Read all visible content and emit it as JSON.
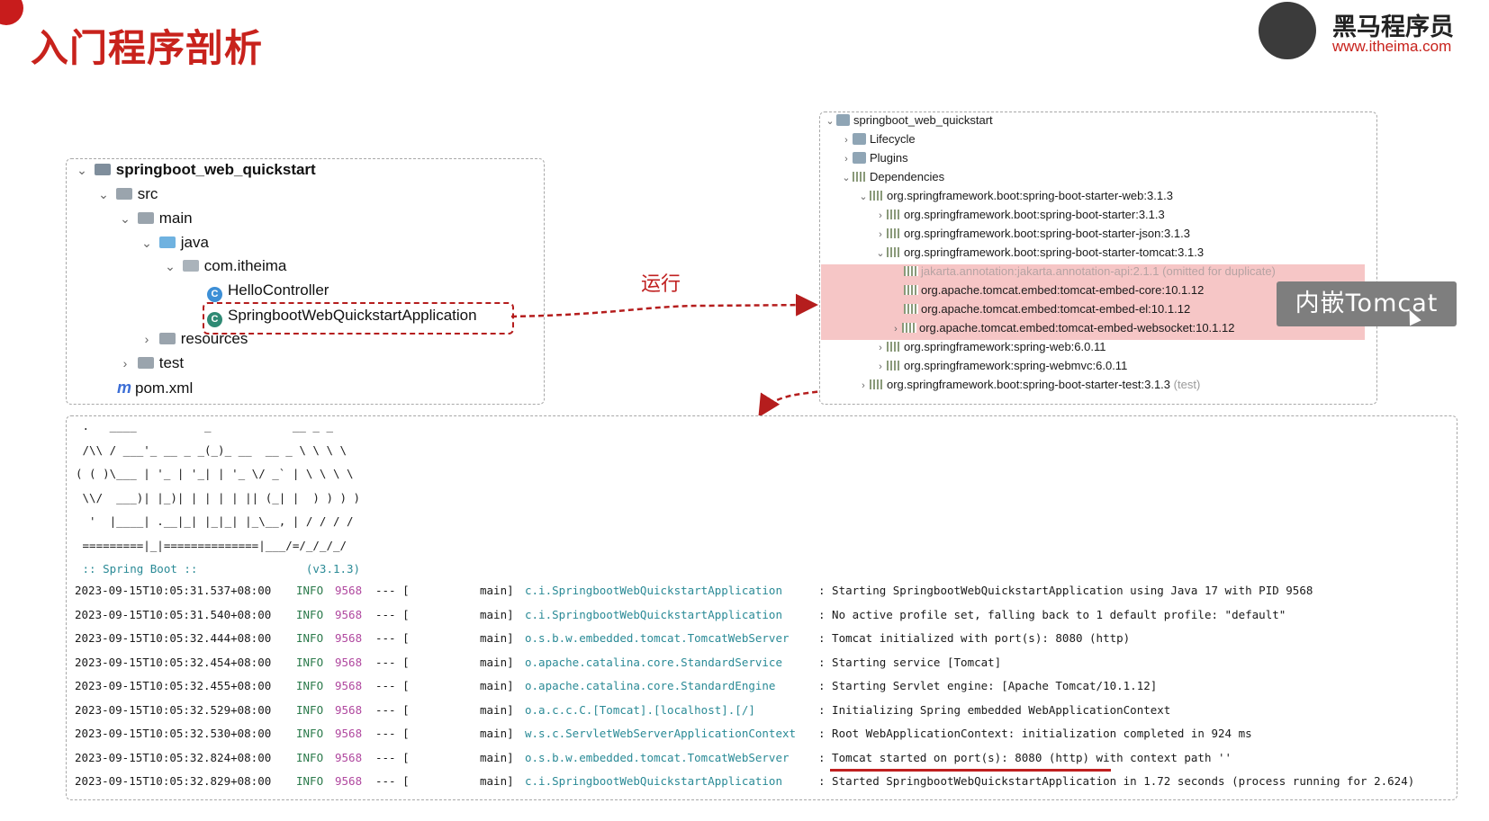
{
  "title": "入门程序剖析",
  "logo": {
    "name": "黑马程序员",
    "url": "www.itheima.com"
  },
  "run_label": "运行",
  "tooltip": "内嵌Tomcat",
  "project_tree": {
    "root": "springboot_web_quickstart",
    "src": "src",
    "main": "main",
    "java": "java",
    "package": "com.itheima",
    "hello": "HelloController",
    "app": "SpringbootWebQuickstartApplication",
    "resources": "resources",
    "test": "test",
    "pom": "pom.xml"
  },
  "maven_tree": {
    "root": "springboot_web_quickstart",
    "lifecycle": "Lifecycle",
    "plugins": "Plugins",
    "dependencies": "Dependencies",
    "starter_web": "org.springframework.boot:spring-boot-starter-web:3.1.3",
    "starter": "org.springframework.boot:spring-boot-starter:3.1.3",
    "starter_json": "org.springframework.boot:spring-boot-starter-json:3.1.3",
    "starter_tomcat": "org.springframework.boot:spring-boot-starter-tomcat:3.1.3",
    "annotation_api": "jakarta.annotation:jakarta.annotation-api:2.1.1",
    "annotation_note": "(omitted for duplicate)",
    "embed_core": "org.apache.tomcat.embed:tomcat-embed-core:10.1.12",
    "embed_el": "org.apache.tomcat.embed:tomcat-embed-el:10.1.12",
    "embed_websocket": "org.apache.tomcat.embed:tomcat-embed-websocket:10.1.12",
    "spring_web": "org.springframework:spring-web:6.0.11",
    "spring_webmvc": "org.springframework:spring-webmvc:6.0.11",
    "starter_test": "org.springframework.boot:spring-boot-starter-test:3.1.3",
    "test_scope": "(test)"
  },
  "console": {
    "banner": [
      " .   ____          _            __ _ _",
      " /\\\\ / ___'_ __ _ _(_)_ __  __ _ \\ \\ \\ \\",
      "( ( )\\___ | '_ | '_| | '_ \\/ _` | \\ \\ \\ \\",
      " \\\\/  ___)| |_)| | | | | || (_| |  ) ) ) )",
      "  '  |____| .__|_| |_|_| |_\\__, | / / / /",
      " =========|_|==============|___/=/_/_/_/",
      " :: Spring Boot ::                (v3.1.3)"
    ],
    "logs": [
      {
        "time": "2023-09-15T10:05:31.537+08:00",
        "level": "INFO",
        "pid": "9568",
        "dash": "--- [",
        "thread": "main]",
        "logger": "c.i.SpringbootWebQuickstartApplication",
        "msg": ": Starting SpringbootWebQuickstartApplication using Java 17 with PID 9568"
      },
      {
        "time": "2023-09-15T10:05:31.540+08:00",
        "level": "INFO",
        "pid": "9568",
        "dash": "--- [",
        "thread": "main]",
        "logger": "c.i.SpringbootWebQuickstartApplication",
        "msg": ": No active profile set, falling back to 1 default profile: \"default\""
      },
      {
        "time": "2023-09-15T10:05:32.444+08:00",
        "level": "INFO",
        "pid": "9568",
        "dash": "--- [",
        "thread": "main]",
        "logger": "o.s.b.w.embedded.tomcat.TomcatWebServer",
        "msg": ": Tomcat initialized with port(s): 8080 (http)"
      },
      {
        "time": "2023-09-15T10:05:32.454+08:00",
        "level": "INFO",
        "pid": "9568",
        "dash": "--- [",
        "thread": "main]",
        "logger": "o.apache.catalina.core.StandardService",
        "msg": ": Starting service [Tomcat]"
      },
      {
        "time": "2023-09-15T10:05:32.455+08:00",
        "level": "INFO",
        "pid": "9568",
        "dash": "--- [",
        "thread": "main]",
        "logger": "o.apache.catalina.core.StandardEngine",
        "msg": ": Starting Servlet engine: [Apache Tomcat/10.1.12]"
      },
      {
        "time": "2023-09-15T10:05:32.529+08:00",
        "level": "INFO",
        "pid": "9568",
        "dash": "--- [",
        "thread": "main]",
        "logger": "o.a.c.c.C.[Tomcat].[localhost].[/]",
        "msg": ": Initializing Spring embedded WebApplicationContext"
      },
      {
        "time": "2023-09-15T10:05:32.530+08:00",
        "level": "INFO",
        "pid": "9568",
        "dash": "--- [",
        "thread": "main]",
        "logger": "w.s.c.ServletWebServerApplicationContext",
        "msg": ": Root WebApplicationContext: initialization completed in 924 ms"
      },
      {
        "time": "2023-09-15T10:05:32.824+08:00",
        "level": "INFO",
        "pid": "9568",
        "dash": "--- [",
        "thread": "main]",
        "logger": "o.s.b.w.embedded.tomcat.TomcatWebServer",
        "msg": ": Tomcat started on port(s): 8080 (http) with context path ''"
      },
      {
        "time": "2023-09-15T10:05:32.829+08:00",
        "level": "INFO",
        "pid": "9568",
        "dash": "--- [",
        "thread": "main]",
        "logger": "c.i.SpringbootWebQuickstartApplication",
        "msg": ": Started SpringbootWebQuickstartApplication in 1.72 seconds (process running for 2.624)"
      }
    ]
  },
  "colors": {
    "accent_red": "#c8221c",
    "highlight": "#f6c6c6",
    "tooltip_bg": "#7e7e7e"
  }
}
